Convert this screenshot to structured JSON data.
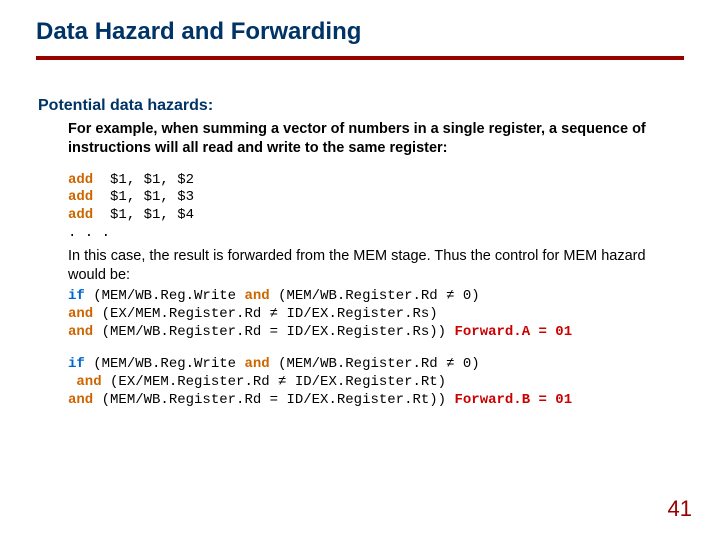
{
  "title": "Data Hazard and Forwarding",
  "section_heading": "Potential data hazards:",
  "intro": "For example, when summing a vector of numbers in a single register, a sequence of instructions will all read and write to the same register:",
  "kw": {
    "add": "add",
    "and": "and",
    "if": "if",
    "fwdA": "Forward.A = 01",
    "fwdB": "Forward.B = 01"
  },
  "asm": {
    "l1": "  $1, $1, $2",
    "l2": "  $1, $1, $3",
    "l3": "  $1, $1, $4",
    "dots": ". . ."
  },
  "explain": "In this case, the result is forwarded from the MEM stage. Thus the control for MEM hazard would be:",
  "condA": {
    "l1": " (MEM/WB.Reg.Write ",
    "l1b": " (MEM/WB.Register.Rd ≠ 0)",
    "l2": " (EX/MEM.Register.Rd ≠ ID/EX.Register.Rs)",
    "l3": " (MEM/WB.Register.Rd = ID/EX.Register.Rs)) "
  },
  "condB": {
    "l1": " (MEM/WB.Reg.Write ",
    "l1b": " (MEM/WB.Register.Rd ≠ 0)",
    "l2": " (EX/MEM.Register.Rd ≠ ID/EX.Register.Rt)",
    "l3": " (MEM/WB.Register.Rd = ID/EX.Register.Rt)) "
  },
  "cond_and_indent": " ",
  "page_number": "41"
}
